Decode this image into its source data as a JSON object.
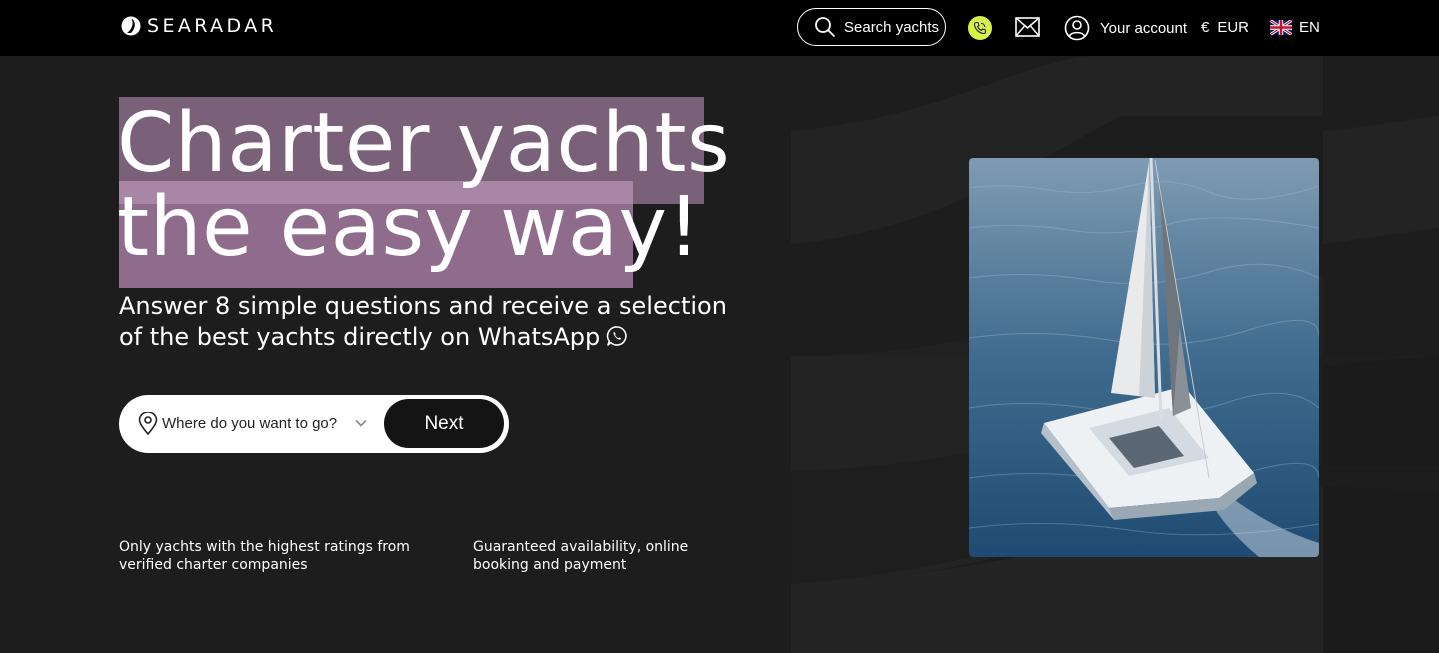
{
  "header": {
    "logo_text": "SEARADAR",
    "search_label": "Search yachts",
    "account_label": "Your account",
    "currency_symbol": "€",
    "currency_code": "EUR",
    "language": "EN"
  },
  "hero": {
    "title_line1": "Charter yachts",
    "title_line2": "the easy way!",
    "subtitle": "Answer 8 simple questions and receive a selection of the best yachts directly on WhatsApp",
    "destination_placeholder": "Where do you want to go?",
    "next_label": "Next"
  },
  "features": [
    "Only yachts with the highest ratings from verified charter companies",
    "Guaranteed availability, online booking and payment"
  ],
  "colors": {
    "header_bg": "#000000",
    "page_bg": "#1d1d1d",
    "highlight": "#7a6078",
    "phone_accent": "#d6f24a"
  },
  "icons": [
    "logo-icon",
    "search-icon",
    "phone-icon",
    "mail-icon",
    "user-icon",
    "uk-flag-icon",
    "whatsapp-icon",
    "location-pin-icon",
    "chevron-down-icon"
  ]
}
